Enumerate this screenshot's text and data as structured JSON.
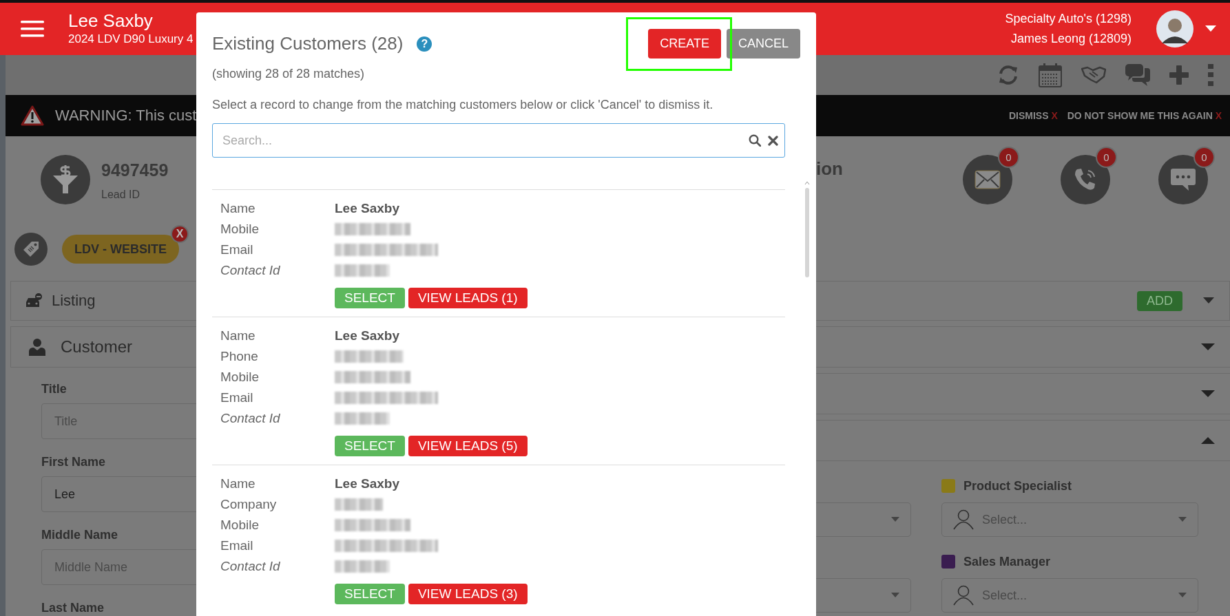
{
  "header": {
    "title": "Lee Saxby",
    "subtitle": "2024 LDV D90 Luxury 4",
    "dealer": "Specialty Auto's (1298)",
    "user": "James Leong (12809)"
  },
  "warning": {
    "text": "WARNING: This cust",
    "actions": [
      {
        "label": "DISMISS",
        "mark": "X"
      },
      {
        "label": "DO NOT SHOW ME THIS AGAIN",
        "mark": "X"
      }
    ]
  },
  "lead": {
    "id": "9497459",
    "id_label": "Lead ID",
    "heading_fragment": "ion"
  },
  "channels": [
    {
      "kind": "email",
      "count": "0"
    },
    {
      "kind": "phone",
      "count": "0"
    },
    {
      "kind": "message",
      "count": "0"
    }
  ],
  "tag": {
    "label": "LDV - WEBSITE",
    "remove": "X"
  },
  "listing": {
    "title": "Listing",
    "action": "ADD",
    "expanded": false
  },
  "customer": {
    "title": "Customer",
    "fields": [
      {
        "label": "Title",
        "placeholder": "Title"
      },
      {
        "label": "First Name",
        "value": "Lee"
      },
      {
        "label": "Middle Name",
        "placeholder": "Middle Name"
      },
      {
        "label": "Last Name"
      }
    ]
  },
  "side_panels": [
    {
      "expanded": false
    },
    {
      "expanded": false
    },
    {
      "expanded": true
    }
  ],
  "assignments": [
    {
      "label": "Product Specialist",
      "color": "#8a7a18",
      "placeholder": "Select..."
    },
    {
      "label": "Sales Manager",
      "color": "#3a1d50",
      "placeholder": "Select..."
    }
  ],
  "modal": {
    "title": "Existing Customers (28)",
    "help": "?",
    "create": {
      "label": "CREATE",
      "highlighted": true
    },
    "cancel": "CANCEL",
    "summary": "(showing 28 of 28 matches)",
    "instruction": "Select a record to change from the matching customers below or click 'Cancel' to dismiss it.",
    "search": {
      "placeholder": "Search..."
    },
    "records": [
      {
        "fields": [
          {
            "kind": "text",
            "label": "Name",
            "value": "Lee Saxby",
            "italic": false
          },
          {
            "kind": "blurred",
            "label": "Mobile",
            "italic": false
          },
          {
            "kind": "blurred",
            "label": "Email",
            "italic": false
          },
          {
            "kind": "blurred",
            "label": "Contact Id",
            "italic": true
          }
        ],
        "select": "SELECT",
        "view": "VIEW LEADS (1)"
      },
      {
        "fields": [
          {
            "kind": "text",
            "label": "Name",
            "value": "Lee Saxby",
            "italic": false
          },
          {
            "kind": "blurred",
            "label": "Phone",
            "italic": false
          },
          {
            "kind": "blurred",
            "label": "Mobile",
            "italic": false
          },
          {
            "kind": "blurred",
            "label": "Email",
            "italic": false
          },
          {
            "kind": "blurred",
            "label": "Contact Id",
            "italic": true
          }
        ],
        "select": "SELECT",
        "view": "VIEW LEADS (5)"
      },
      {
        "fields": [
          {
            "kind": "text",
            "label": "Name",
            "value": "Lee Saxby",
            "italic": false
          },
          {
            "kind": "blurred",
            "label": "Company",
            "italic": false
          },
          {
            "kind": "blurred",
            "label": "Mobile",
            "italic": false
          },
          {
            "kind": "blurred",
            "label": "Email",
            "italic": false
          },
          {
            "kind": "blurred",
            "label": "Contact Id",
            "italic": true
          }
        ],
        "select": "SELECT",
        "view": "VIEW LEADS (3)"
      }
    ]
  }
}
